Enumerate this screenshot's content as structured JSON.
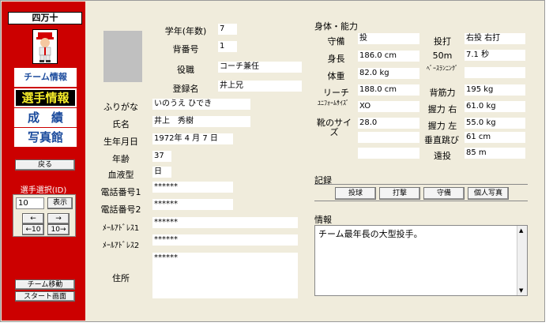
{
  "sidebar": {
    "team_name": "四万十",
    "nav": {
      "team_info": "チーム情報",
      "player_info": "選手情報",
      "results": "成　績",
      "photo_gallery": "写真館"
    },
    "back": "戻る",
    "player_select_label": "選手選択(ID)",
    "id_value": "10",
    "show": "表示",
    "prev": "←",
    "next": "→",
    "prev10": "←10",
    "next10": "10→",
    "team_move": "チーム移動",
    "start_screen": "スタート画面"
  },
  "profile": {
    "grade_label": "学年(年数)",
    "grade": "7",
    "number_label": "背番号",
    "number": "1",
    "role_label": "役職",
    "role": "コーチ兼任",
    "reg_name_label": "登録名",
    "reg_name": "井上兄",
    "furigana_label": "ふりがな",
    "furigana": "いのうえ ひでき",
    "name_label": "氏名",
    "name": "井上　秀樹",
    "birthday_label": "生年月日",
    "birthday": "1972年 4 月 7 日",
    "age_label": "年齢",
    "age": "37",
    "blood_label": "血液型",
    "blood": "日",
    "phone1_label": "電話番号1",
    "phone1": "******",
    "phone2_label": "電話番号2",
    "phone2": "******",
    "mail1_label": "ﾒｰﾙｱﾄﾞﾚｽ1",
    "mail1": "******",
    "mail2_label": "ﾒｰﾙｱﾄﾞﾚｽ2",
    "mail2": "******",
    "address_label": "住所",
    "address": "******"
  },
  "body": {
    "title": "身体・能力",
    "position_label": "守備",
    "position": "投",
    "bats_label": "投打",
    "bats": "右投 右打",
    "height_label": "身長",
    "height": "186.0 cm",
    "run50_label": "50m",
    "run50": "7.1 秒",
    "weight_label": "体重",
    "weight": "82.0 kg",
    "base_label": "ﾍﾞｰｽﾗﾝﾆﾝｸﾞ",
    "base": "",
    "reach_label": "リーチ",
    "reach": "188.0 cm",
    "back_label": "背筋力",
    "back": "195 kg",
    "uniform_label": "ﾕﾆﾌｫｰﾑｻｲｽﾞ",
    "uniform": "XO",
    "grip_r_label": "握力 右",
    "grip_r": "61.0 kg",
    "shoe_label": "靴のサイズ",
    "shoe": "28.0",
    "grip_l_label": "握力 左",
    "grip_l": "55.0 kg",
    "vjump_label": "垂直跳び",
    "vjump": "61 cm",
    "throw_label": "遠投",
    "throw": "85 m"
  },
  "record": {
    "title": "記録",
    "pitching": "投球",
    "batting": "打撃",
    "fielding": "守備",
    "personal_photo": "個人写真"
  },
  "info": {
    "title": "情報",
    "text": "チーム最年長の大型投手。"
  }
}
